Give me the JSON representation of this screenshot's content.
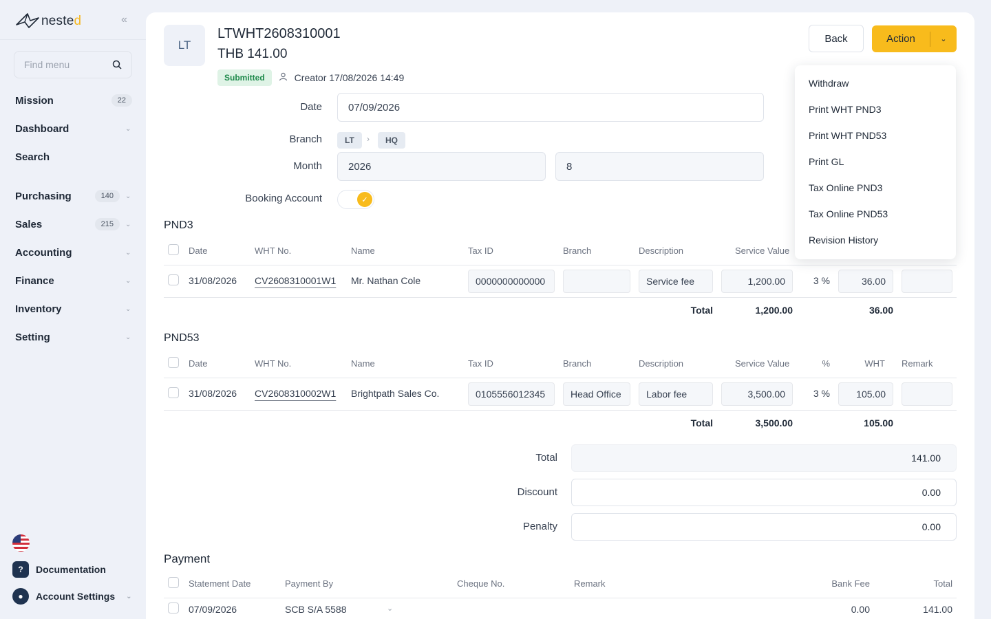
{
  "sidebar": {
    "logo_text": "neste",
    "logo_accent": "d",
    "search_placeholder": "Find menu",
    "items": [
      {
        "label": "Mission",
        "badge": "22",
        "chevron": false
      },
      {
        "label": "Dashboard",
        "badge": "",
        "chevron": true
      },
      {
        "label": "Search",
        "badge": "",
        "chevron": false
      },
      {
        "label": "Purchasing",
        "badge": "140",
        "chevron": true
      },
      {
        "label": "Sales",
        "badge": "215",
        "chevron": true
      },
      {
        "label": "Accounting",
        "badge": "",
        "chevron": true
      },
      {
        "label": "Finance",
        "badge": "",
        "chevron": true
      },
      {
        "label": "Inventory",
        "badge": "",
        "chevron": true
      },
      {
        "label": "Setting",
        "badge": "",
        "chevron": true
      }
    ],
    "documentation": "Documentation",
    "account_settings": "Account Settings"
  },
  "header": {
    "avatar": "LT",
    "doc_no": "LTWHT2608310001",
    "amount": "THB 141.00",
    "status": "Submitted",
    "creator": "Creator 17/08/2026 14:49",
    "back": "Back",
    "action": "Action"
  },
  "form": {
    "date_label": "Date",
    "date": "07/09/2026",
    "branch_label": "Branch",
    "branch_from": "LT",
    "branch_to": "HQ",
    "month_label": "Month",
    "year": "2026",
    "month": "8",
    "booking_label": "Booking Account",
    "booking_on": true
  },
  "columns": [
    "Date",
    "WHT No.",
    "Name",
    "Tax ID",
    "Branch",
    "Description",
    "Service Value",
    "%",
    "WHT",
    "Remark"
  ],
  "pnd3": {
    "title": "PND3",
    "row": {
      "date": "31/08/2026",
      "wht_no": "CV2608310001W1",
      "name": "Mr. Nathan Cole",
      "tax_id": "0000000000000",
      "branch": "",
      "description": "Service fee",
      "service_value": "1,200.00",
      "percent": "3 %",
      "wht": "36.00",
      "remark": ""
    },
    "total_label": "Total",
    "total_value": "1,200.00",
    "total_wht": "36.00"
  },
  "pnd53": {
    "title": "PND53",
    "row": {
      "date": "31/08/2026",
      "wht_no": "CV2608310002W1",
      "name": "Brightpath Sales Co.",
      "tax_id": "0105556012345",
      "branch": "Head Office",
      "description": "Labor fee",
      "service_value": "3,500.00",
      "percent": "3 %",
      "wht": "105.00",
      "remark": ""
    },
    "total_label": "Total",
    "total_value": "3,500.00",
    "total_wht": "105.00"
  },
  "summary": {
    "total_label": "Total",
    "total": "141.00",
    "discount_label": "Discount",
    "discount": "0.00",
    "penalty_label": "Penalty",
    "penalty": "0.00"
  },
  "payment": {
    "title": "Payment",
    "columns": [
      "Statement Date",
      "Payment By",
      "Cheque No.",
      "Remark",
      "Bank Fee",
      "Total"
    ],
    "row": {
      "date": "07/09/2026",
      "payment_by": "SCB S/A 5588",
      "cheque": "",
      "remark": "",
      "bank_fee": "0.00",
      "total": "141.00"
    }
  },
  "action_menu": [
    "Withdraw",
    "Print WHT PND3",
    "Print WHT PND53",
    "Print GL",
    "Tax Online PND3",
    "Tax Online PND53",
    "Revision History"
  ],
  "colors": {
    "accent": "#f8bb1c",
    "status_bg": "#dff3e6",
    "status_text": "#1f8a4c"
  }
}
